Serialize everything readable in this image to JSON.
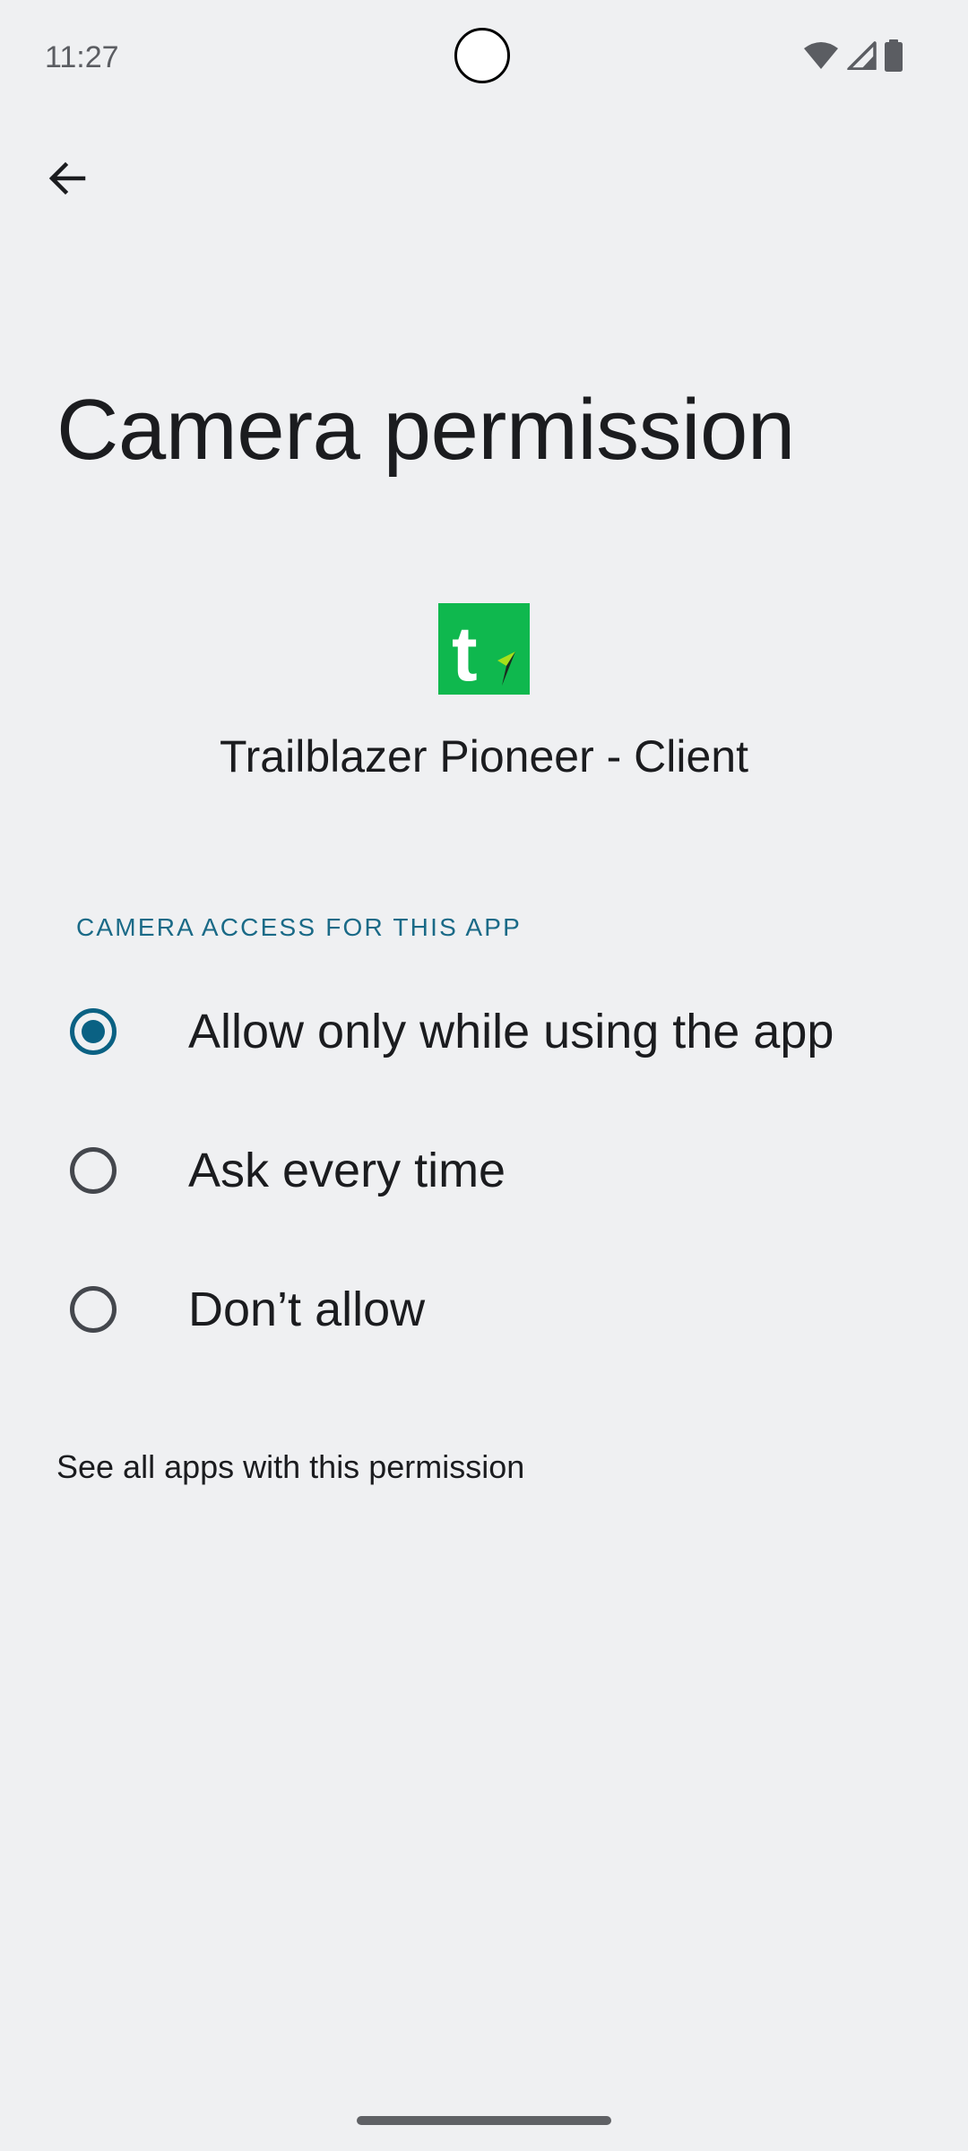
{
  "status_bar": {
    "time": "11:27",
    "icons": [
      "wifi-icon",
      "cellular-signal-icon",
      "battery-icon"
    ]
  },
  "header": {
    "back_icon": "arrow-back-icon",
    "title": "Camera permission"
  },
  "app": {
    "icon_letter": "t",
    "icon_color": "#0fb84e",
    "name": "Trailblazer Pioneer - Client"
  },
  "section": {
    "header": "CAMERA ACCESS FOR THIS APP"
  },
  "options": [
    {
      "label": "Allow only while using the app",
      "selected": true
    },
    {
      "label": "Ask every time",
      "selected": false
    },
    {
      "label": "Don’t allow",
      "selected": false
    }
  ],
  "footer": {
    "link": "See all apps with this permission"
  },
  "colors": {
    "background": "#eff0f2",
    "accent": "#0a6183",
    "section_header": "#1a6a87"
  }
}
